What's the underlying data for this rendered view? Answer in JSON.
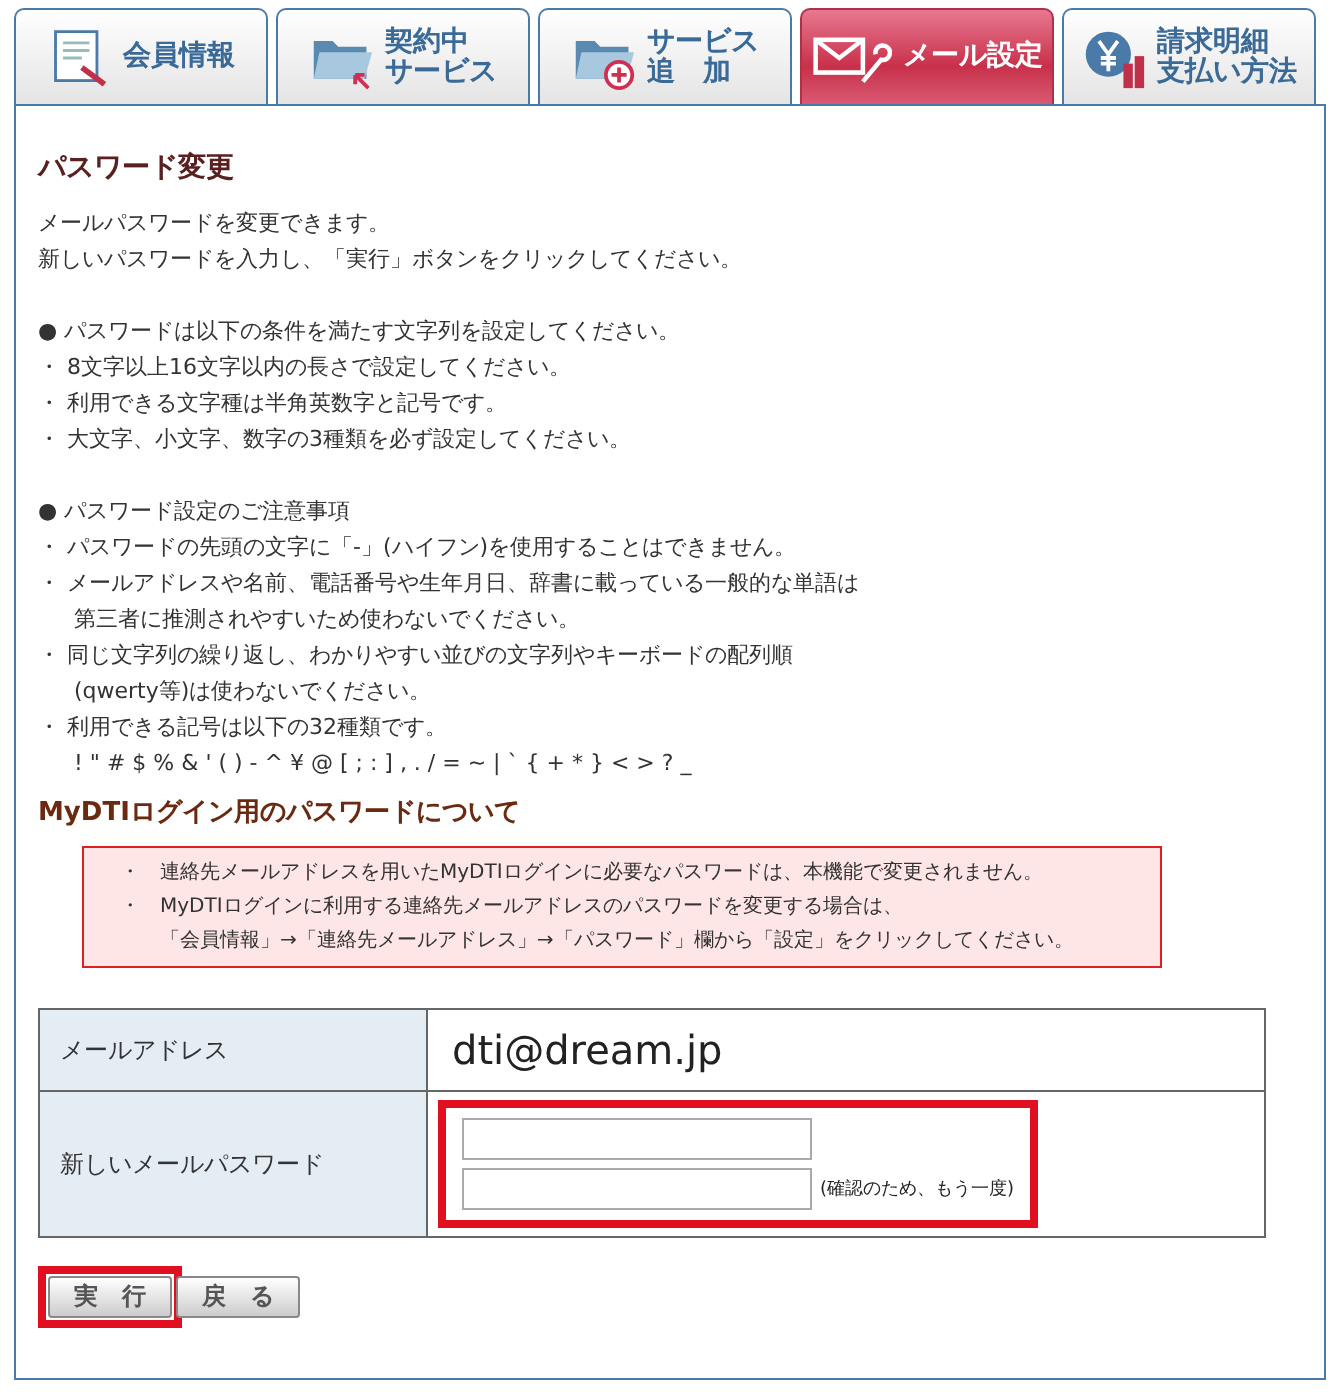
{
  "tabs": [
    {
      "kind": "document",
      "lines": [
        "会員情報"
      ],
      "selected": false
    },
    {
      "kind": "folder-arrow",
      "lines": [
        "契約中",
        "サービス"
      ],
      "selected": false
    },
    {
      "kind": "folder-plus",
      "lines": [
        "サービス",
        "追　加"
      ],
      "selected": false
    },
    {
      "kind": "mail-wrench",
      "lines": [
        "メール設定"
      ],
      "selected": true
    },
    {
      "kind": "yen",
      "lines": [
        "請求明細",
        "支払い方法"
      ],
      "selected": false
    }
  ],
  "title": "パスワード変更",
  "intro": [
    "メールパスワードを変更できます。",
    "新しいパスワードを入力し、「実行」ボタンをクリックしてください。"
  ],
  "sections": [
    {
      "bullet": "●",
      "heading": "パスワードは以下の条件を満たす文字列を設定してください。",
      "items": [
        {
          "mark": "・",
          "lines": [
            "8文字以上16文字以内の長さで設定してください。"
          ]
        },
        {
          "mark": "・",
          "lines": [
            "利用できる文字種は半角英数字と記号です。"
          ]
        },
        {
          "mark": "・",
          "lines": [
            "大文字、小文字、数字の3種類を必ず設定してください。"
          ]
        }
      ]
    },
    {
      "bullet": "●",
      "heading": "パスワード設定のご注意事項",
      "items": [
        {
          "mark": "・",
          "lines": [
            "パスワードの先頭の文字に「-」(ハイフン)を使用することはできません。"
          ]
        },
        {
          "mark": "・",
          "lines": [
            "メールアドレスや名前、電話番号や生年月日、辞書に載っている一般的な単語は",
            "第三者に推測されやすいため使わないでください。"
          ]
        },
        {
          "mark": "・",
          "lines": [
            "同じ文字列の繰り返し、わかりやすい並びの文字列やキーボードの配列順",
            "(qwerty等)は使わないでください。"
          ]
        },
        {
          "mark": "・",
          "lines": [
            "利用できる記号は以下の32種類です。",
            "! \" # $ % & ' ( ) - ^ ¥ @ [ ; : ] , . / = ~ | ` { + * } < > ? _"
          ]
        }
      ]
    }
  ],
  "subtitle": "MyDTIログイン用のパスワードについて",
  "notice": [
    {
      "mark": "・",
      "lines": [
        "連絡先メールアドレスを用いたMyDTIログインに必要なパスワードは、本機能で変更されません。"
      ]
    },
    {
      "mark": "・",
      "lines": [
        "MyDTIログインに利用する連絡先メールアドレスのパスワードを変更する場合は、",
        "「会員情報」→「連絡先メールアドレス」→「パスワード」欄から「設定」をクリックしてください。"
      ]
    }
  ],
  "form": {
    "email_label": "メールアドレス",
    "email": "dti@dream.jp",
    "password_label": "新しいメールパスワード",
    "confirm_note": "(確認のため、もう一度)",
    "highlighted": true
  },
  "buttons": [
    {
      "label": "実　行",
      "highlighted": true
    },
    {
      "label": "戻　る",
      "highlighted": false
    }
  ]
}
